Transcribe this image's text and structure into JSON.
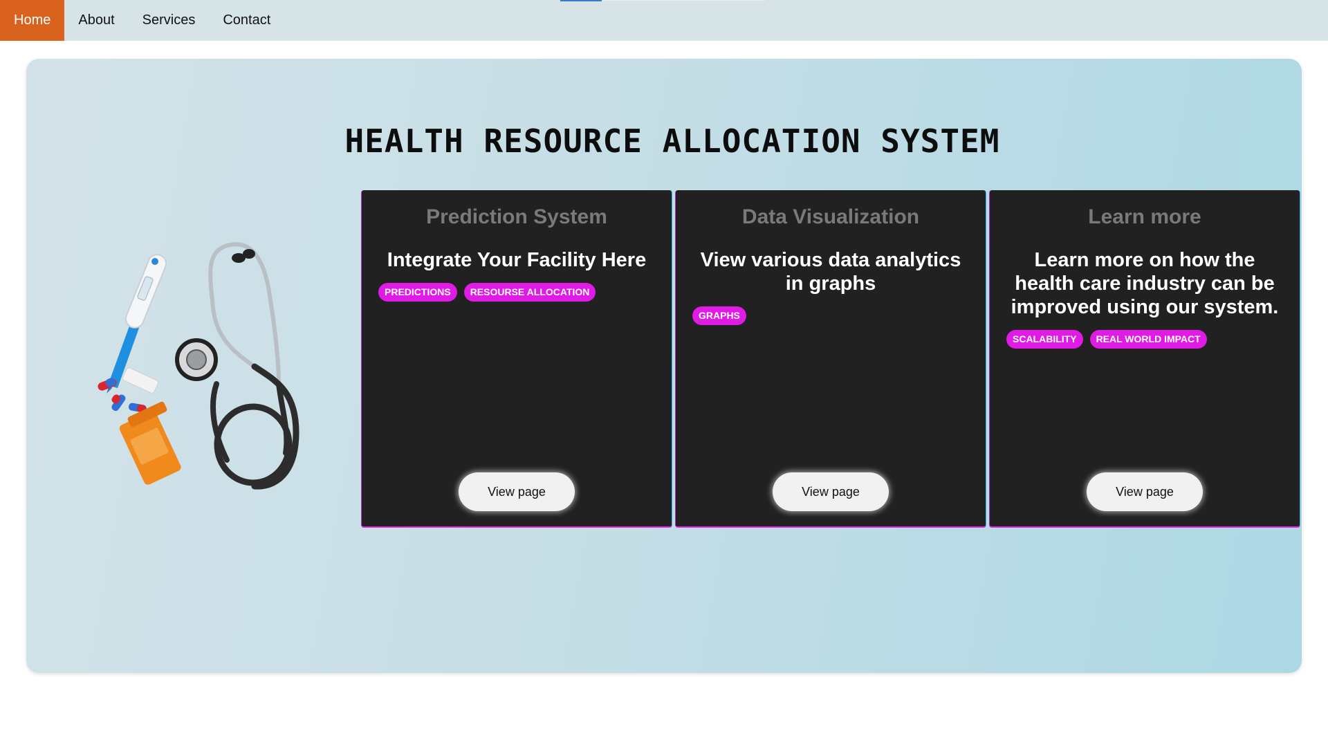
{
  "nav": {
    "items": [
      {
        "label": "Home",
        "active": true
      },
      {
        "label": "About"
      },
      {
        "label": "Services"
      },
      {
        "label": "Contact"
      }
    ]
  },
  "hero": {
    "title": "HEALTH RESOURCE ALLOCATION SYSTEM",
    "illustration": "medical-tools-illustration"
  },
  "cards": [
    {
      "title": "Prediction System",
      "heading": "Integrate Your Facility Here",
      "tags": [
        "PREDICTIONS",
        "RESOURSE ALLOCATION"
      ],
      "button": "View page"
    },
    {
      "title": "Data Visualization",
      "heading": "View various data analytics in graphs",
      "tags": [
        "GRAPHS"
      ],
      "button": "View page"
    },
    {
      "title": "Learn more",
      "heading": "Learn more on how the health care industry can be improved using our system.",
      "tags": [
        "SCALABILITY",
        "REAL WORLD IMPACT"
      ],
      "button": "View page"
    }
  ],
  "colors": {
    "nav_active": "#d9621f",
    "card_bg": "#212121",
    "tag_bg": "#e11be6"
  }
}
